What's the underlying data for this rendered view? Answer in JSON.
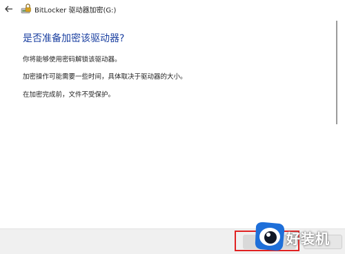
{
  "window": {
    "title": "BitLocker 驱动器加密(G:)",
    "back_icon": "back-arrow-icon",
    "app_icon": "bitlocker-drive-icon"
  },
  "content": {
    "heading": "是否准备加密该驱动器?",
    "paragraphs": [
      "你将能够使用密码解锁该驱动器。",
      "加密操作可能需要一些时间，具体取决于驱动器的大小。",
      "在加密完成前，文件不受保护。"
    ]
  },
  "footer": {
    "primary_label": "",
    "cancel_label": ""
  },
  "watermark": {
    "text": "好装机"
  },
  "colors": {
    "heading": "#1a3fa0",
    "highlight": "#e02020",
    "watermark_blue": "#1e6fd9"
  }
}
